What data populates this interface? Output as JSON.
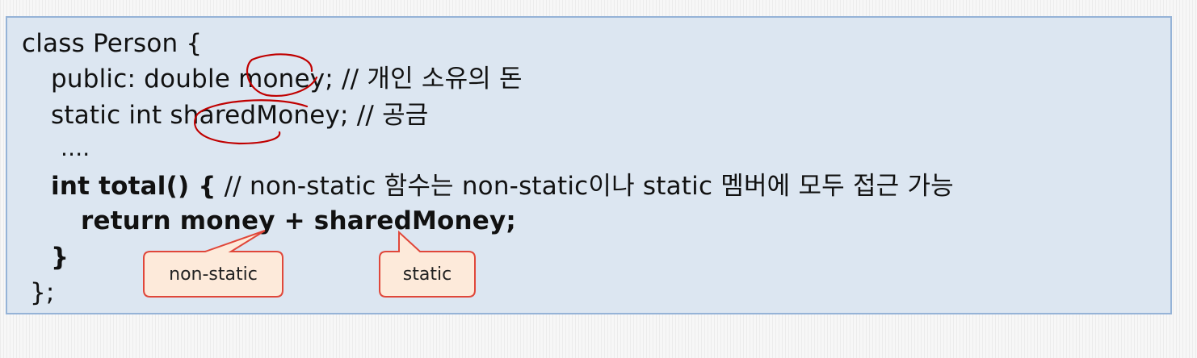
{
  "code": {
    "line1": "class Person {",
    "line2": "public: double money; // 개인 소유의 돈",
    "line3": "static int sharedMoney; // 공금",
    "line4": "....",
    "line5_bold": "int total() {",
    "line5_rest": " // non-static 함수는 non-static이나 static 멤버에 모두 접근 가능",
    "line6": "return money + sharedMoney;",
    "line7": "}",
    "line8": "};"
  },
  "callouts": {
    "left": "non-static",
    "right": "static"
  },
  "colors": {
    "box_fill": "#dce6f1",
    "box_border": "#95b3d7",
    "callout_fill": "#fdeada",
    "callout_border": "#e0473a",
    "handwriting": "#c00000"
  }
}
